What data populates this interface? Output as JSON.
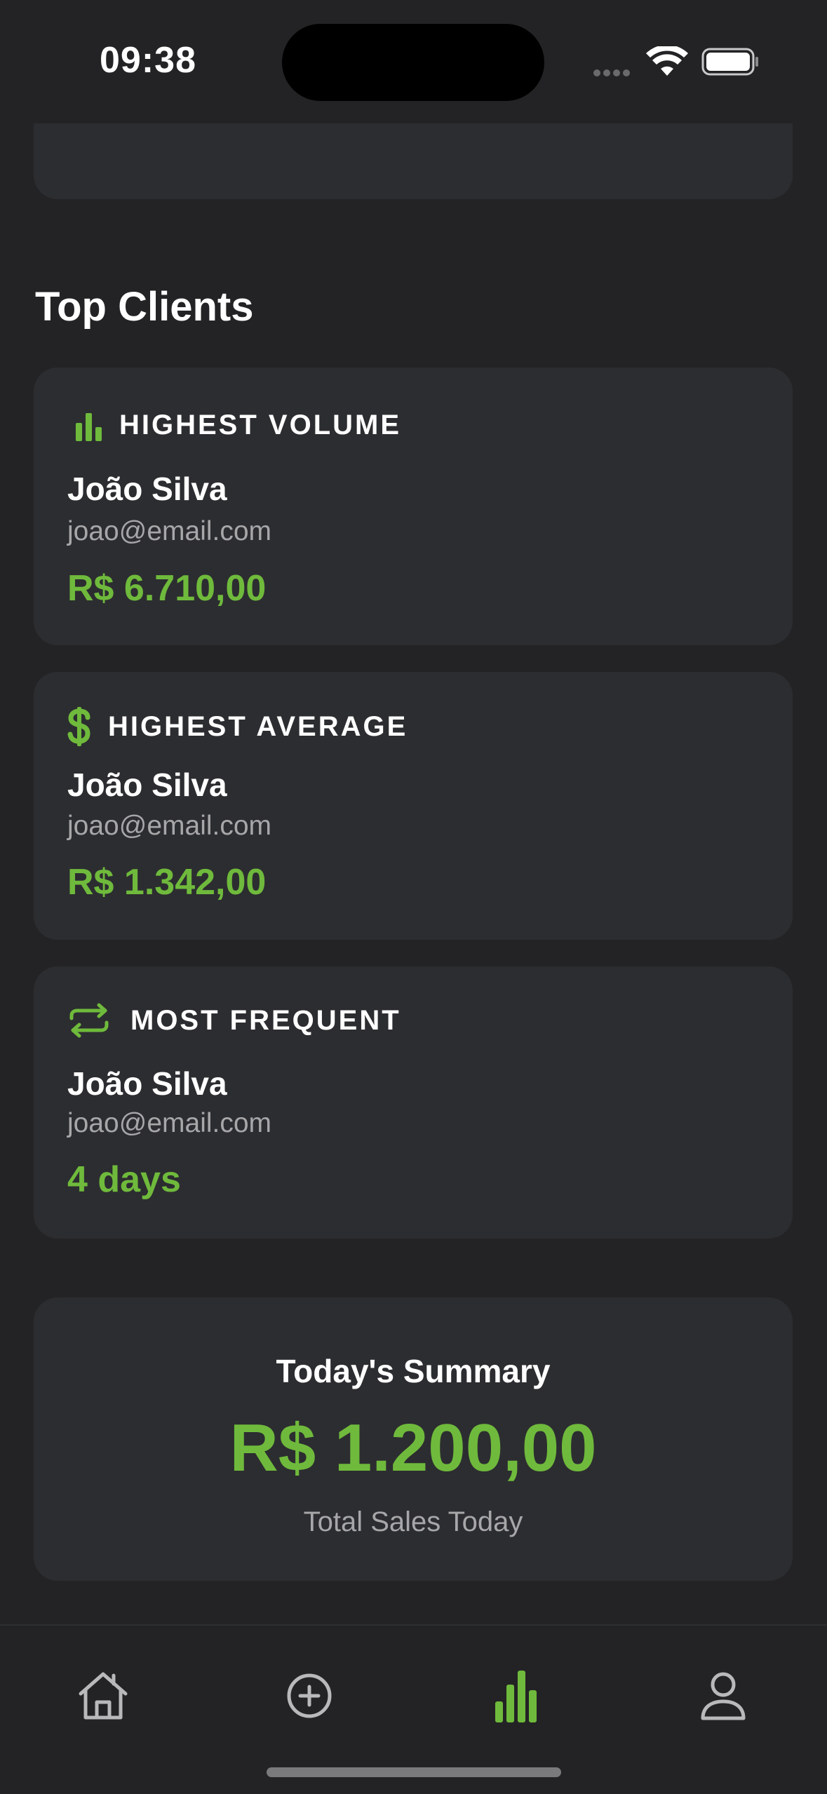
{
  "status_bar": {
    "time": "09:38"
  },
  "top_clients": {
    "title": "Top Clients",
    "cards": [
      {
        "icon": "bar-chart-icon",
        "label": "HIGHEST VOLUME",
        "name": "João Silva",
        "email": "joao@email.com",
        "value": "R$ 6.710,00"
      },
      {
        "icon": "dollar-icon",
        "label": "HIGHEST AVERAGE",
        "name": "João Silva",
        "email": "joao@email.com",
        "value": "R$ 1.342,00"
      },
      {
        "icon": "repeat-icon",
        "label": "MOST FREQUENT",
        "name": "João Silva",
        "email": "joao@email.com",
        "value": "4 days"
      }
    ]
  },
  "summary": {
    "title": "Today's Summary",
    "value": "R$ 1.200,00",
    "caption": "Total Sales Today"
  },
  "tab_bar": {
    "items": [
      {
        "icon": "home-icon",
        "active": false
      },
      {
        "icon": "add-circle-icon",
        "active": false
      },
      {
        "icon": "stats-icon",
        "active": true
      },
      {
        "icon": "profile-icon",
        "active": false
      }
    ]
  },
  "colors": {
    "accent": "#6fba3c",
    "background": "#232325",
    "card": "#2c2d30",
    "muted_text": "#a7a7aa",
    "inactive_icon": "#b9b9bc"
  }
}
